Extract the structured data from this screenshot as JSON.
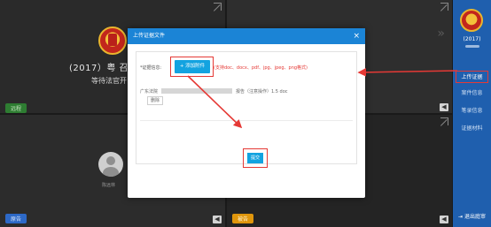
{
  "video": {
    "case_title": "(2017）粤    召",
    "wait_text": "等待法官开",
    "green_tag": "远程",
    "blue_tag": "原告",
    "orange_tag": "被告",
    "avatar_name": "陈远林"
  },
  "sidebar": {
    "case_title": "(2017)",
    "items": [
      {
        "label": "上传证据",
        "active": true
      },
      {
        "label": "案件信息",
        "active": false
      },
      {
        "label": "笔录信息",
        "active": false
      },
      {
        "label": "证据材料",
        "active": false
      }
    ],
    "exit_label": "退出庭审"
  },
  "modal": {
    "title": "上传证据文件",
    "close_label": "×",
    "evidence_label": "*证据信息:",
    "add_button": "+ 添加附件",
    "type_hint": "(支持doc、docx、pdf、jpg、jpeg、png格式)",
    "file_prefix": "广东法院",
    "file_suffix": "报告（注意操作）1.5 doc",
    "delete_button": "删除",
    "submit_button": "提交"
  },
  "colors": {
    "sidebar": "#1f5fae",
    "modal_header": "#1b84d6",
    "primary_button": "#13a3e0",
    "highlight": "#e53935"
  }
}
